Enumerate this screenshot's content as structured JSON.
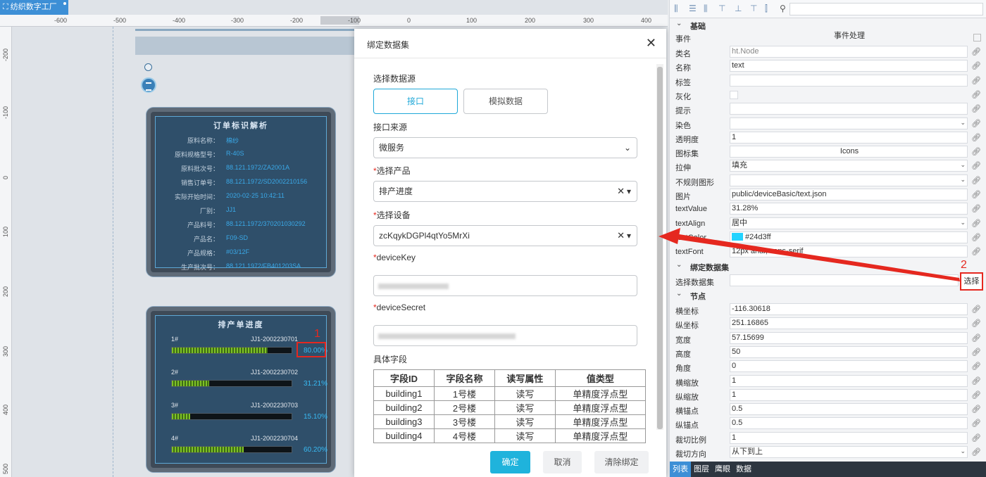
{
  "app": {
    "badge": "纺织数字工厂"
  },
  "rulers": {
    "top": [
      "-600",
      "-500",
      "-400",
      "-300",
      "-200",
      "-100",
      "0",
      "100",
      "200",
      "300",
      "400"
    ],
    "left": [
      "-200",
      "-100",
      "0",
      "100",
      "200",
      "300",
      "400",
      "500"
    ]
  },
  "order_panel": {
    "title": "订单标识解析",
    "rows": [
      {
        "k": "原料名称：",
        "v": "棉纱"
      },
      {
        "k": "原料规格型号：",
        "v": "R-40S"
      },
      {
        "k": "原料批次号：",
        "v": "88.121.1972/ZA2001A"
      },
      {
        "k": "销售订单号：",
        "v": "88.121.1972/SD2002210156"
      },
      {
        "k": "实际开始时间：",
        "v": "2020-02-25 10:42:11"
      },
      {
        "k": "厂别：",
        "v": "JJ1"
      },
      {
        "k": "产品料号：",
        "v": "88.121.1972/370201030292"
      },
      {
        "k": "产品名：",
        "v": "F09-SD"
      },
      {
        "k": "产品规格：",
        "v": "#03/12F"
      },
      {
        "k": "生产批次号：",
        "v": "88.121.1972/FB401203SA"
      }
    ]
  },
  "schedule_panel": {
    "title": "排产单进度",
    "rows": [
      {
        "idx": "1#",
        "code": "JJ1-2002230701",
        "pct": "80.00%",
        "value": 0.8
      },
      {
        "idx": "2#",
        "code": "JJ1-2002230702",
        "pct": "31.21%",
        "value": 0.3121
      },
      {
        "idx": "3#",
        "code": "JJ1-2002230703",
        "pct": "15.10%",
        "value": 0.151
      },
      {
        "idx": "4#",
        "code": "JJ1-2002230704",
        "pct": "60.20%",
        "value": 0.602
      }
    ]
  },
  "annotations": {
    "one": "1",
    "two": "2"
  },
  "modal": {
    "title": "绑定数据集",
    "source_label": "选择数据源",
    "source_api": "接口",
    "source_mock": "模拟数据",
    "api_source_label": "接口来源",
    "api_source_value": "微服务",
    "product_label": "选择产品",
    "product_value": "排产进度",
    "device_label": "选择设备",
    "device_value": "zcKqykDGPl4qtYo5MrXi",
    "device_key_label": "deviceKey",
    "device_secret_label": "deviceSecret",
    "fields_label": "具体字段",
    "table_headers": [
      "字段ID",
      "字段名称",
      "读写属性",
      "值类型"
    ],
    "table_rows": [
      [
        "building1",
        "1号楼",
        "读写",
        "单精度浮点型"
      ],
      [
        "building2",
        "2号楼",
        "读写",
        "单精度浮点型"
      ],
      [
        "building3",
        "3号楼",
        "读写",
        "单精度浮点型"
      ],
      [
        "building4",
        "4号楼",
        "读写",
        "单精度浮点型"
      ]
    ],
    "btn_ok": "确定",
    "btn_cancel": "取消",
    "btn_clear": "清除绑定"
  },
  "props": {
    "sections": {
      "basic": "基础",
      "binding": "绑定数据集",
      "node": "节点"
    },
    "event_label": "事件",
    "event_value": "事件处理",
    "rows_basic": [
      {
        "label": "类名",
        "value": "ht.Node",
        "style": "gray"
      },
      {
        "label": "名称",
        "value": "text"
      },
      {
        "label": "标签",
        "value": ""
      },
      {
        "label": "灰化",
        "value": ""
      },
      {
        "label": "提示",
        "value": ""
      },
      {
        "label": "染色",
        "value": ""
      },
      {
        "label": "透明度",
        "value": "1"
      },
      {
        "label": "图标集",
        "value": "Icons",
        "style": "center"
      },
      {
        "label": "拉伸",
        "value": "填充"
      },
      {
        "label": "不规则图形",
        "value": ""
      },
      {
        "label": "图片",
        "value": "public/deviceBasic/text.json"
      },
      {
        "label": "textValue",
        "value": "31.28%"
      },
      {
        "label": "textAlign",
        "value": "居中"
      },
      {
        "label": "textColor",
        "value": "#24d3ff"
      },
      {
        "label": "textFont",
        "value": "12px arial, sans-serif"
      }
    ],
    "binding_label": "选择数据集",
    "select_btn": "选择",
    "rows_node": [
      {
        "label": "横坐标",
        "value": "-116.30618"
      },
      {
        "label": "纵坐标",
        "value": "251.16865"
      },
      {
        "label": "宽度",
        "value": "57.15699"
      },
      {
        "label": "高度",
        "value": "50"
      },
      {
        "label": "角度",
        "value": "0"
      },
      {
        "label": "横缩放",
        "value": "1"
      },
      {
        "label": "纵缩放",
        "value": "1"
      },
      {
        "label": "横锚点",
        "value": "0.5"
      },
      {
        "label": "纵锚点",
        "value": "0.5"
      },
      {
        "label": "裁切比例",
        "value": "1"
      },
      {
        "label": "裁切方向",
        "value": "从下到上"
      }
    ],
    "tabs": [
      "列表",
      "图层",
      "鹰眼",
      "数据"
    ]
  },
  "colors": {
    "accent": "#1fa8d8",
    "annotation": "#e5281f",
    "text_color_swatch": "#24d3ff"
  }
}
